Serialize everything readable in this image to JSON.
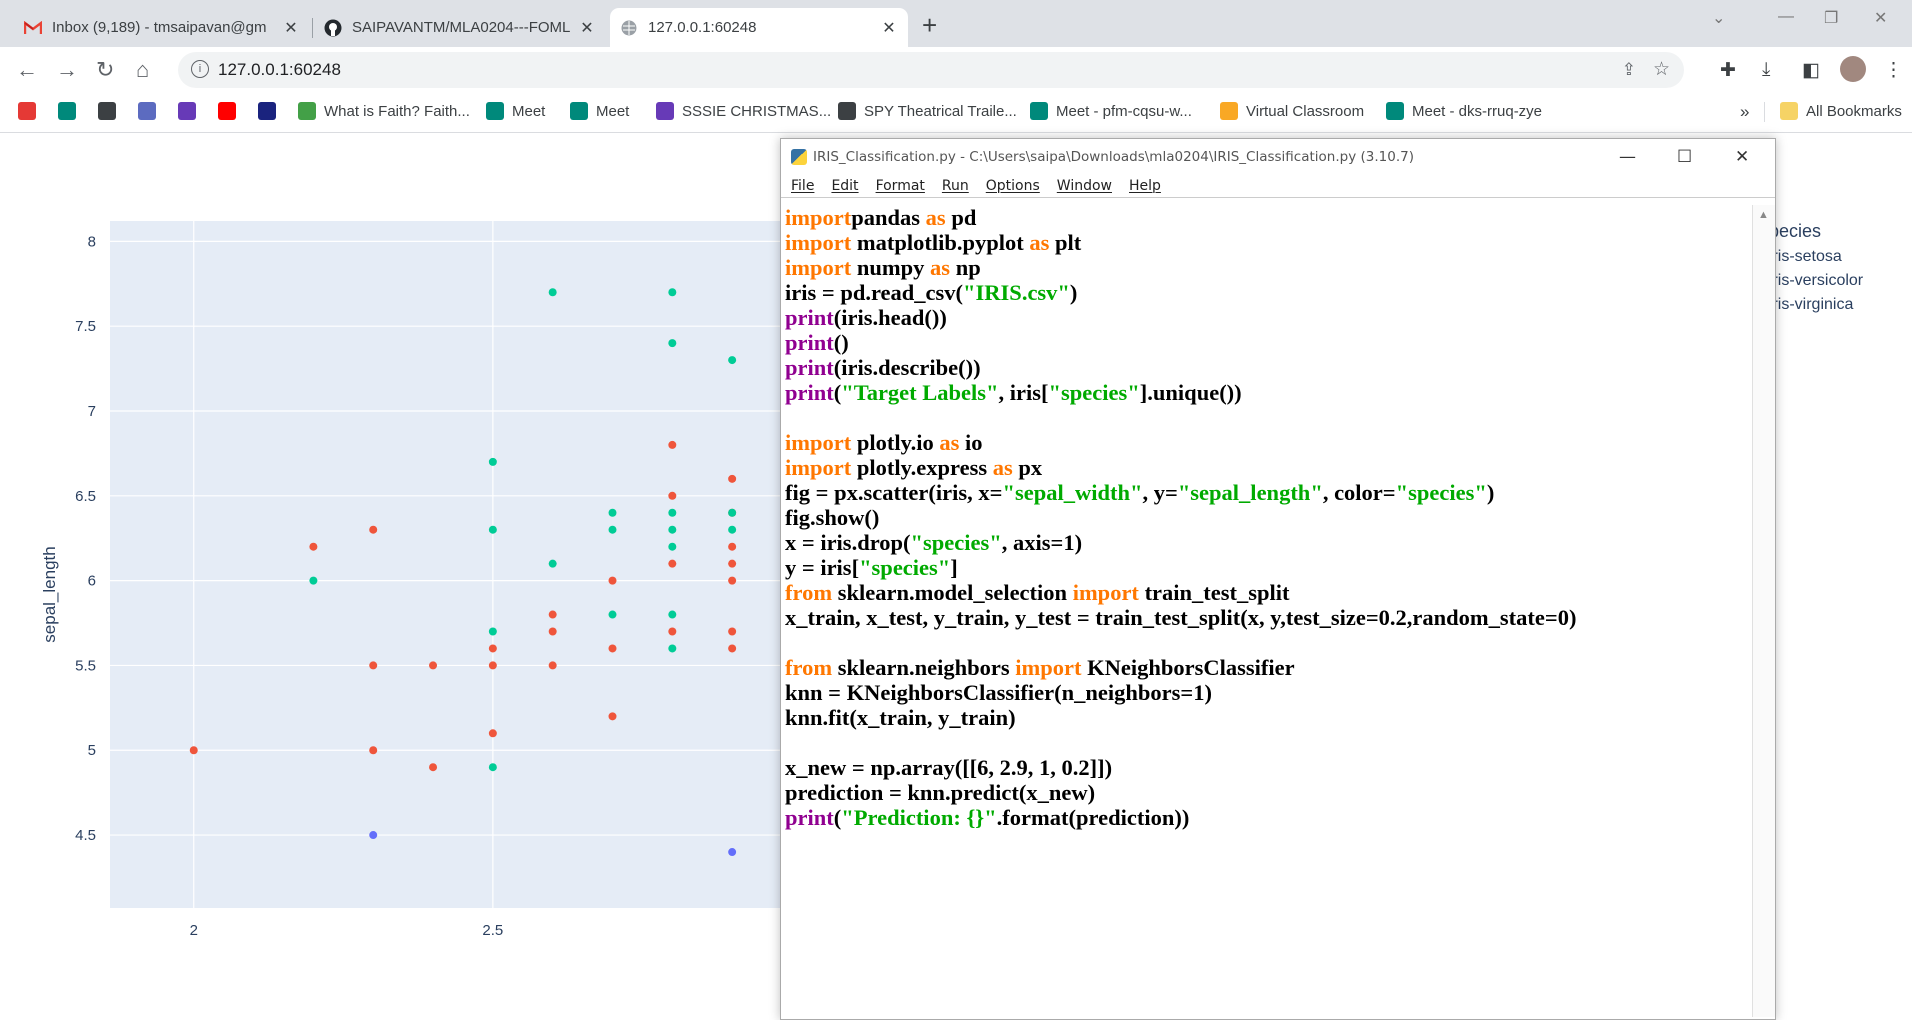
{
  "browser": {
    "tabs": [
      {
        "title": "Inbox (9,189) - tmsaipavan@gm",
        "icon": "gmail-icon"
      },
      {
        "title": "SAIPAVANTM/MLA0204---FOML",
        "icon": "github-icon"
      },
      {
        "title": "127.0.0.1:60248",
        "icon": "globe-icon"
      }
    ],
    "url": "127.0.0.1:60248",
    "bookmarks": [
      {
        "label": "",
        "icon": "heart-icon",
        "color": "#e53935"
      },
      {
        "label": "",
        "icon": "meet-icon",
        "color": "#00897b"
      },
      {
        "label": "",
        "icon": "globe-icon",
        "color": "#3c4043"
      },
      {
        "label": "",
        "icon": "puzzle-icon",
        "color": "#5c6bc0"
      },
      {
        "label": "",
        "icon": "forms-icon",
        "color": "#673ab7"
      },
      {
        "label": "",
        "icon": "youtube-icon",
        "color": "#ff0000"
      },
      {
        "label": "",
        "icon": "book-icon",
        "color": "#1a237e"
      },
      {
        "label": "What is Faith? Faith...",
        "icon": "leaf-icon",
        "color": "#43a047"
      },
      {
        "label": "Meet",
        "icon": "meet-icon",
        "color": "#00897b"
      },
      {
        "label": "Meet",
        "icon": "meet-icon",
        "color": "#00897b"
      },
      {
        "label": "SSSIE CHRISTMAS...",
        "icon": "forms-icon",
        "color": "#673ab7"
      },
      {
        "label": "SPY Theatrical Traile...",
        "icon": "globe-icon",
        "color": "#3c4043"
      },
      {
        "label": "Meet - pfm-cqsu-w...",
        "icon": "meet-icon",
        "color": "#00897b"
      },
      {
        "label": "Virtual Classroom",
        "icon": "star-icon",
        "color": "#f9a825"
      },
      {
        "label": "Meet - dks-rruq-zye",
        "icon": "meet-icon",
        "color": "#00897b"
      }
    ],
    "more_bookmarks": "»",
    "all_bookmarks": "All Bookmarks"
  },
  "legend": {
    "title": "species",
    "items": [
      "Iris-setosa",
      "Iris-versicolor",
      "Iris-virginica"
    ]
  },
  "chart_data": {
    "type": "scatter",
    "xlabel": "",
    "ylabel": "sepal_length",
    "xlim": [
      1.86,
      2.98
    ],
    "ylim": [
      4.07,
      8.12
    ],
    "x_ticks": [
      "2",
      "2.5"
    ],
    "x_tick_values": [
      2,
      2.5
    ],
    "y_ticks": [
      "4.5",
      "5",
      "5.5",
      "6",
      "6.5",
      "7",
      "7.5",
      "8"
    ],
    "y_tick_values": [
      4.5,
      5,
      5.5,
      6,
      6.5,
      7,
      7.5,
      8
    ],
    "series": [
      {
        "name": "Iris-setosa",
        "color": "#636efa",
        "points": [
          [
            2.3,
            4.5
          ],
          [
            2.9,
            4.4
          ]
        ]
      },
      {
        "name": "Iris-versicolor",
        "color": "#ef553b",
        "points": [
          [
            2.0,
            5.0
          ],
          [
            2.2,
            6.2
          ],
          [
            2.3,
            6.3
          ],
          [
            2.3,
            5.5
          ],
          [
            2.3,
            5.0
          ],
          [
            2.4,
            5.5
          ],
          [
            2.4,
            4.9
          ],
          [
            2.5,
            5.6
          ],
          [
            2.5,
            5.5
          ],
          [
            2.5,
            5.1
          ],
          [
            2.6,
            5.8
          ],
          [
            2.6,
            5.7
          ],
          [
            2.6,
            5.5
          ],
          [
            2.7,
            6.0
          ],
          [
            2.7,
            5.6
          ],
          [
            2.7,
            5.2
          ],
          [
            2.8,
            6.8
          ],
          [
            2.8,
            6.5
          ],
          [
            2.8,
            6.1
          ],
          [
            2.8,
            5.7
          ],
          [
            2.9,
            6.6
          ],
          [
            2.9,
            6.4
          ],
          [
            2.9,
            6.2
          ],
          [
            2.9,
            6.1
          ],
          [
            2.9,
            6.0
          ],
          [
            2.9,
            5.7
          ],
          [
            2.9,
            5.6
          ]
        ]
      },
      {
        "name": "Iris-virginica",
        "color": "#00cc96",
        "points": [
          [
            2.2,
            6.0
          ],
          [
            2.5,
            6.7
          ],
          [
            2.5,
            6.3
          ],
          [
            2.5,
            5.7
          ],
          [
            2.5,
            4.9
          ],
          [
            2.6,
            7.7
          ],
          [
            2.6,
            6.1
          ],
          [
            2.7,
            6.4
          ],
          [
            2.7,
            6.3
          ],
          [
            2.7,
            5.8
          ],
          [
            2.8,
            7.7
          ],
          [
            2.8,
            7.4
          ],
          [
            2.8,
            6.4
          ],
          [
            2.8,
            6.3
          ],
          [
            2.8,
            6.2
          ],
          [
            2.8,
            5.8
          ],
          [
            2.8,
            5.6
          ],
          [
            2.9,
            7.3
          ],
          [
            2.9,
            6.4
          ],
          [
            2.9,
            6.3
          ]
        ]
      }
    ]
  },
  "idle": {
    "title": "IRIS_Classification.py - C:\\Users\\saipa\\Downloads\\mla0204\\IRIS_Classification.py (3.10.7)",
    "menu": [
      "File",
      "Edit",
      "Format",
      "Run",
      "Options",
      "Window",
      "Help"
    ],
    "code": [
      [
        [
          "kw",
          "import"
        ],
        [
          "",
          "pandas "
        ],
        [
          "kw",
          "as"
        ],
        [
          "",
          " pd"
        ]
      ],
      [
        [
          "kw",
          "import"
        ],
        [
          "",
          " matplotlib.pyplot "
        ],
        [
          "kw",
          "as"
        ],
        [
          "",
          " plt"
        ]
      ],
      [
        [
          "kw",
          "import"
        ],
        [
          "",
          " numpy "
        ],
        [
          "kw",
          "as"
        ],
        [
          "",
          " np"
        ]
      ],
      [
        [
          "",
          "iris = pd.read_csv("
        ],
        [
          "st",
          "\"IRIS.csv\""
        ],
        [
          "",
          ")"
        ]
      ],
      [
        [
          "bi",
          "print"
        ],
        [
          "",
          "(iris.head())"
        ]
      ],
      [
        [
          "bi",
          "print"
        ],
        [
          "",
          "()"
        ]
      ],
      [
        [
          "bi",
          "print"
        ],
        [
          "",
          "(iris.describe())"
        ]
      ],
      [
        [
          "bi",
          "print"
        ],
        [
          "",
          "("
        ],
        [
          "st",
          "\"Target Labels\""
        ],
        [
          "",
          ", iris["
        ],
        [
          "st",
          "\"species\""
        ],
        [
          "",
          "].unique())"
        ]
      ],
      [
        [
          "",
          ""
        ]
      ],
      [
        [
          "kw",
          "import"
        ],
        [
          "",
          " plotly.io "
        ],
        [
          "kw",
          "as"
        ],
        [
          "",
          " io"
        ]
      ],
      [
        [
          "kw",
          "import"
        ],
        [
          "",
          " plotly.express "
        ],
        [
          "kw",
          "as"
        ],
        [
          "",
          " px"
        ]
      ],
      [
        [
          "",
          "fig = px.scatter(iris, x="
        ],
        [
          "st",
          "\"sepal_width\""
        ],
        [
          "",
          ", y="
        ],
        [
          "st",
          "\"sepal_length\""
        ],
        [
          "",
          ", color="
        ],
        [
          "st",
          "\"species\""
        ],
        [
          "",
          ")"
        ]
      ],
      [
        [
          "",
          "fig.show()"
        ]
      ],
      [
        [
          "",
          "x = iris.drop("
        ],
        [
          "st",
          "\"species\""
        ],
        [
          "",
          ", axis=1)"
        ]
      ],
      [
        [
          "",
          "y = iris["
        ],
        [
          "st",
          "\"species\""
        ],
        [
          "",
          "]"
        ]
      ],
      [
        [
          "kw",
          "from"
        ],
        [
          "",
          " sklearn.model_selection "
        ],
        [
          "kw",
          "import"
        ],
        [
          "",
          " train_test_split"
        ]
      ],
      [
        [
          "",
          "x_train, x_test, y_train, y_test = train_test_split(x, y,test_size=0.2,random_state=0)"
        ]
      ],
      [
        [
          "",
          ""
        ]
      ],
      [
        [
          "kw",
          "from"
        ],
        [
          "",
          " sklearn.neighbors "
        ],
        [
          "kw",
          "import"
        ],
        [
          "",
          " KNeighborsClassifier"
        ]
      ],
      [
        [
          "",
          "knn = KNeighborsClassifier(n_neighbors=1)"
        ]
      ],
      [
        [
          "",
          "knn.fit(x_train, y_train)"
        ]
      ],
      [
        [
          "",
          ""
        ]
      ],
      [
        [
          "",
          "x_new = np.array([[6, 2.9, 1, 0.2]])"
        ]
      ],
      [
        [
          "",
          "prediction = knn.predict(x_new)"
        ]
      ],
      [
        [
          "bi",
          "print"
        ],
        [
          "",
          "("
        ],
        [
          "st",
          "\"Prediction: {}\""
        ],
        [
          "",
          ".format(prediction))"
        ]
      ]
    ]
  }
}
